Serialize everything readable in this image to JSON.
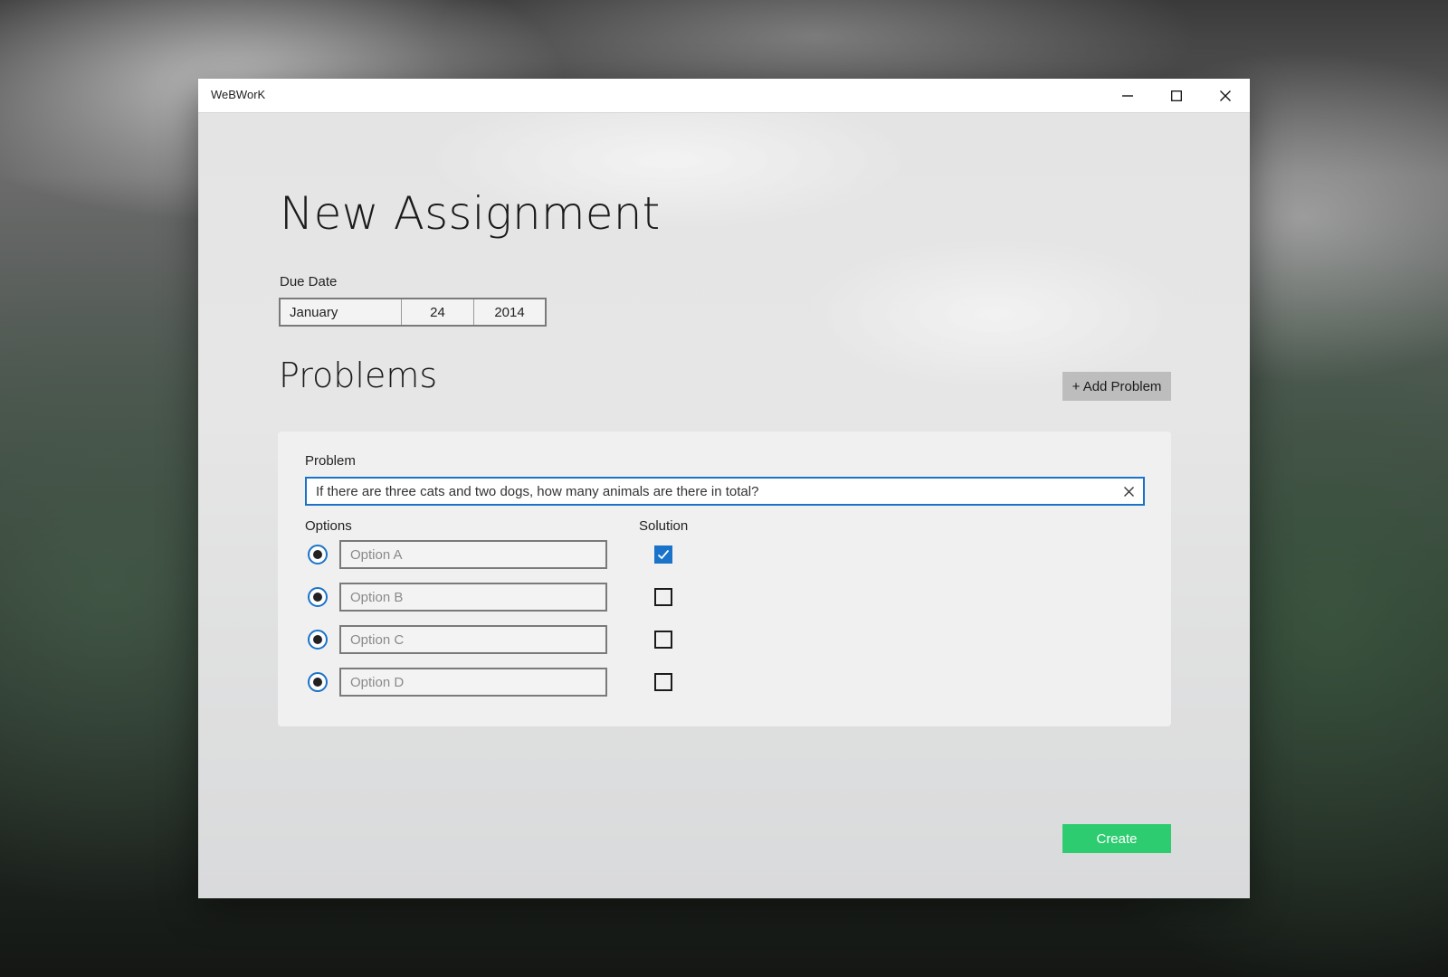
{
  "window": {
    "title": "WeBWorK"
  },
  "page": {
    "title": "New Assignment"
  },
  "due_date": {
    "label": "Due Date",
    "month": "January",
    "day": "24",
    "year": "2014"
  },
  "problems": {
    "title": "Problems",
    "add_button": "+ Add Problem"
  },
  "problem_card": {
    "problem_label": "Problem",
    "problem_text": "If there are three cats and two dogs, how many animals are there in total?",
    "options_label": "Options",
    "solution_label": "Solution",
    "options": [
      {
        "placeholder": "Option A",
        "solution_checked": true
      },
      {
        "placeholder": "Option B",
        "solution_checked": false
      },
      {
        "placeholder": "Option C",
        "solution_checked": false
      },
      {
        "placeholder": "Option D",
        "solution_checked": false
      }
    ]
  },
  "footer": {
    "create_button": "Create"
  },
  "colors": {
    "accent": "#1a73c9",
    "create": "#2ecc71",
    "add_button": "#bdbdbd"
  },
  "icons": {
    "minimize": "minimize-icon",
    "maximize": "maximize-icon",
    "close": "close-icon",
    "clear": "clear-icon",
    "check": "checkmark-icon"
  }
}
